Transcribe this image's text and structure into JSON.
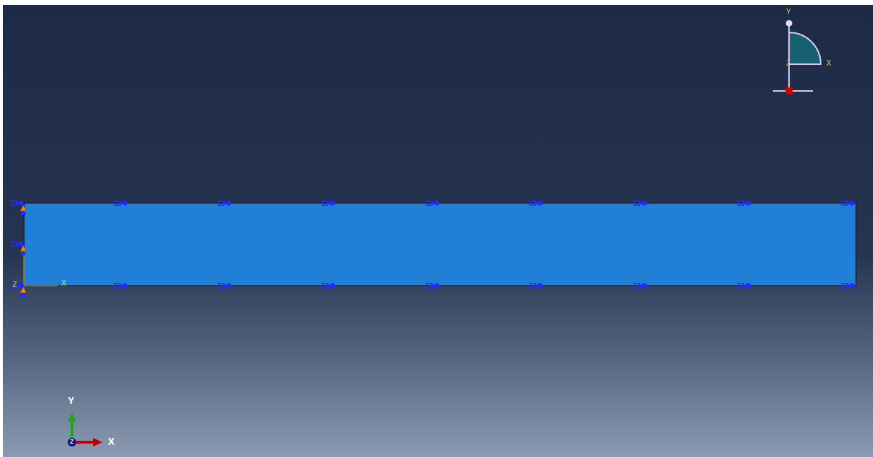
{
  "view_manipulator": {
    "y_label": "Y",
    "z_label": "Z",
    "x_label": "X"
  },
  "part_csys": {
    "z_label": "Z",
    "x_label": "X"
  },
  "triad": {
    "y_label": "Y",
    "z_label": "Z",
    "x_label": "X"
  }
}
